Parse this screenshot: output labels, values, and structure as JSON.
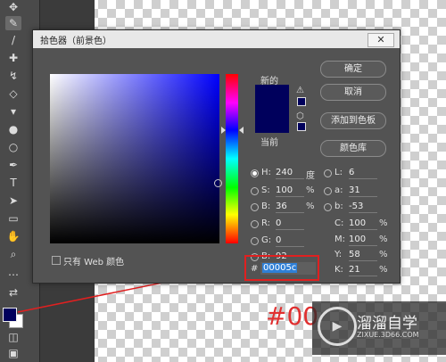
{
  "dialog": {
    "title": "拾色器（前景色）",
    "new_label": "新的",
    "current_label": "当前",
    "close_icon": "close-icon",
    "buttons": {
      "ok": "确定",
      "cancel": "取消",
      "add_swatch": "添加到色板",
      "libraries": "颜色库"
    },
    "hsb": {
      "h_label": "H:",
      "h_value": "240",
      "h_unit": "度",
      "s_label": "S:",
      "s_value": "100",
      "s_unit": "%",
      "b_label": "B:",
      "b_value": "36",
      "b_unit": "%"
    },
    "rgb": {
      "r_label": "R:",
      "r_value": "0",
      "g_label": "G:",
      "g_value": "0",
      "b_label": "B:",
      "b_value": "92"
    },
    "lab": {
      "l_label": "L:",
      "l_value": "6",
      "a_label": "a:",
      "a_value": "31",
      "b_label": "b:",
      "b_value": "-53"
    },
    "cmyk": {
      "c_label": "C:",
      "c_value": "100",
      "m_label": "M:",
      "m_value": "100",
      "y_label": "Y:",
      "y_value": "58",
      "k_label": "K:",
      "k_value": "21",
      "unit": "%"
    },
    "web_only_label": "只有 Web 颜色",
    "hex_prefix": "#",
    "hex_value": "00005c"
  },
  "annotation_text": "#00",
  "watermark": {
    "title": "溜溜自学",
    "subtitle": "ZIXUE.3D66.COM",
    "logo": "play-icon"
  },
  "colors": {
    "picked": "#00005c",
    "accent_red": "#e02020"
  }
}
